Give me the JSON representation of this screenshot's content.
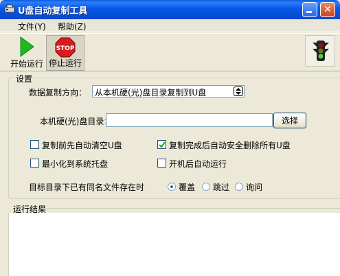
{
  "window": {
    "title": "U盘自动复制工具"
  },
  "menu": {
    "file_label": "文件(Y)",
    "help_label": "帮助(Z)"
  },
  "toolbar": {
    "start_label": "开始运行",
    "stop_label": "停止运行",
    "stop_icon_text": "STOP"
  },
  "settings": {
    "group_label": "设置",
    "direction_label": "数据复制方向：",
    "direction_value": "从本机硬(光)盘目录复制到U盘",
    "dir_label": "本机硬(光)盘目录：",
    "dir_value": "",
    "choose_button": "选择",
    "checkboxes": [
      {
        "label": "复制前先自动清空U盘",
        "checked": false
      },
      {
        "label": "复制完成后自动安全删除所有U盘",
        "checked": true
      },
      {
        "label": "最小化到系统托盘",
        "checked": false
      },
      {
        "label": "开机后自动运行",
        "checked": false
      }
    ],
    "conflict_label": "目标目录下已有同名文件存在时",
    "radios": [
      {
        "label": "覆盖",
        "selected": true
      },
      {
        "label": "跳过",
        "selected": false
      },
      {
        "label": "询问",
        "selected": false
      }
    ]
  },
  "results": {
    "label": "运行结果",
    "content": ""
  },
  "icons": {
    "title": "usb-drive-icon",
    "start": "play-icon",
    "stop": "stop-sign-icon",
    "traffic": "traffic-light-icon"
  },
  "colors": {
    "titlebar": "#0958e8",
    "play": "#1fb81f",
    "stop": "#d81c1c",
    "traffic_green": "#3ad83a",
    "bg": "#ece9d8"
  }
}
